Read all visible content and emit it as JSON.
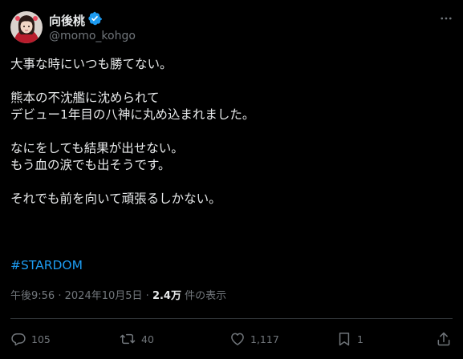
{
  "author": {
    "display_name": "向後桃",
    "handle": "@momo_kohgo",
    "verified": true
  },
  "tweet": {
    "lines": [
      "大事な時にいつも勝てない。",
      "",
      "熊本の不沈艦に沈められて",
      "デビュー1年目の八神に丸め込まれました。",
      "",
      "なにをしても結果が出せない。",
      "もう血の涙でも出そうです。",
      "",
      "それでも前を向いて頑張るしかない。"
    ],
    "hashtag": "#STARDOM"
  },
  "meta": {
    "time": "午後9:56",
    "date": "2024年10月5日",
    "separator": "·",
    "views": "2.4万",
    "views_label": "件の表示"
  },
  "actions": {
    "reply_count": "105",
    "retweet_count": "40",
    "like_count": "1,117",
    "bookmark_count": "1"
  },
  "colors": {
    "background": "#000000",
    "text": "#e7e9ea",
    "muted": "#71767b",
    "accent": "#1d9bf0",
    "divider": "#2f3336"
  }
}
